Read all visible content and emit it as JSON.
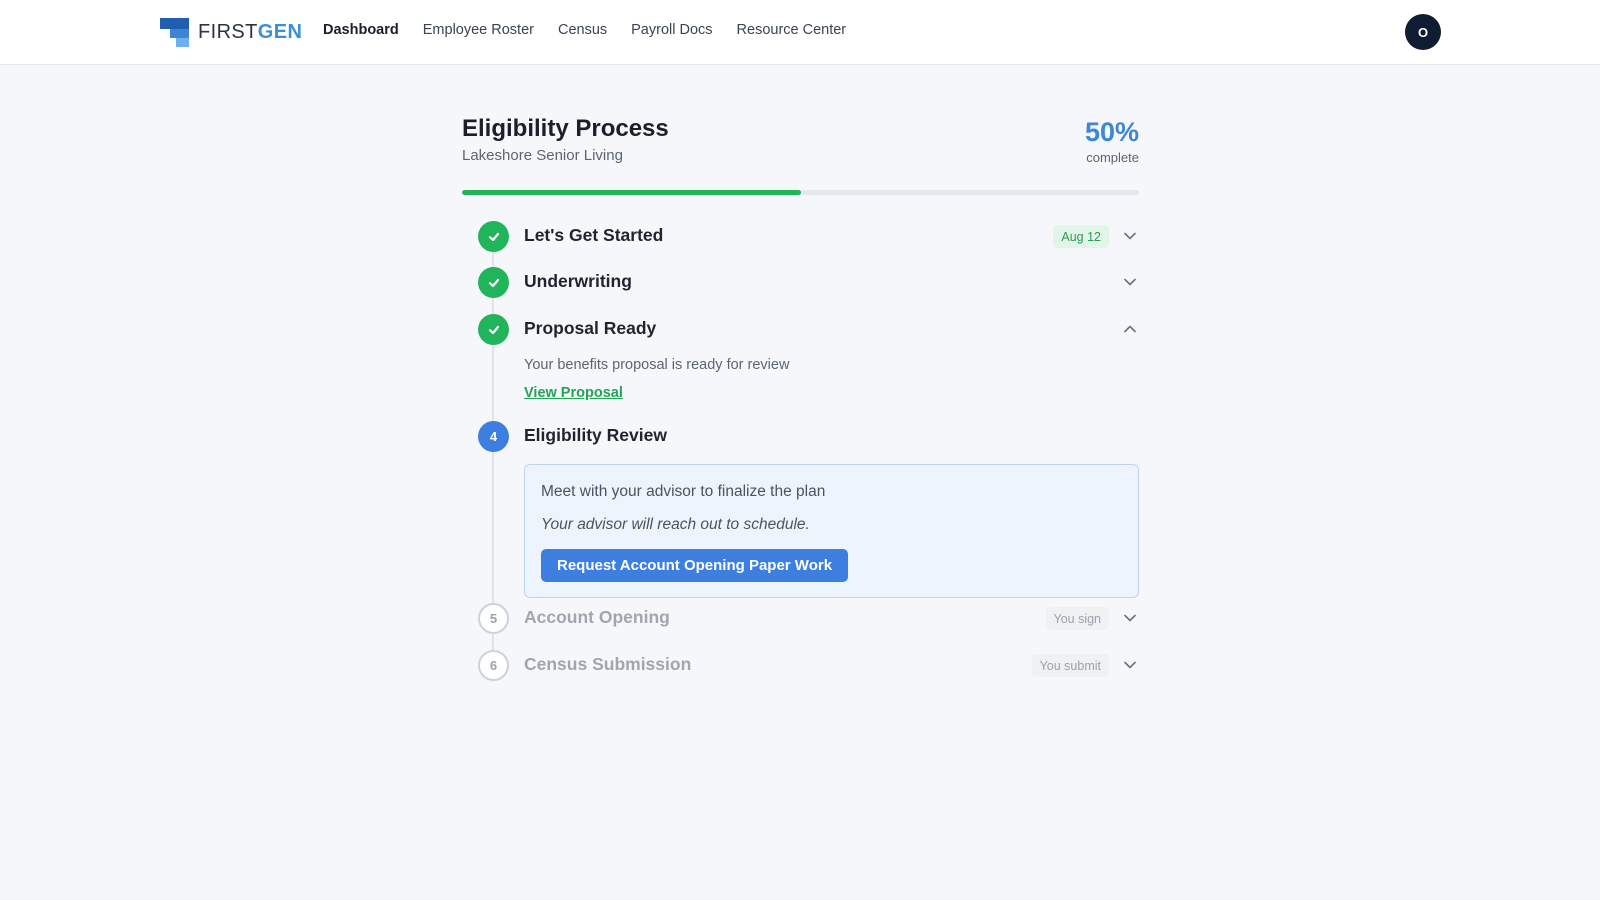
{
  "brand": {
    "first": "FIRST",
    "gen": "GEN",
    "colors": {
      "dark": "#1f5fae",
      "mid": "#3a86d4",
      "light": "#6fb1ee"
    }
  },
  "nav": {
    "items": [
      {
        "label": "Dashboard",
        "active": true
      },
      {
        "label": "Employee Roster",
        "active": false
      },
      {
        "label": "Census",
        "active": false
      },
      {
        "label": "Payroll Docs",
        "active": false
      },
      {
        "label": "Resource Center",
        "active": false
      }
    ]
  },
  "user": {
    "initial": "O"
  },
  "process": {
    "title": "Eligibility Process",
    "company": "Lakeshore Senior Living",
    "percent_text": "50%",
    "percent_label": "complete",
    "progress_value": 0.5
  },
  "steps": [
    {
      "number": "1",
      "status": "done",
      "title": "Let's Get Started",
      "badge": "Aug 12",
      "expanded": false
    },
    {
      "number": "2",
      "status": "done",
      "title": "Underwriting",
      "badge": "",
      "expanded": false
    },
    {
      "number": "3",
      "status": "done",
      "title": "Proposal Ready",
      "badge": "",
      "expanded": true,
      "description": "Your benefits proposal is ready for review",
      "link": "View Proposal"
    },
    {
      "number": "4",
      "status": "active",
      "title": "Eligibility Review",
      "expanded": true,
      "panel_text": "Meet with your advisor to finalize the plan",
      "panel_note": "Your advisor will reach out to schedule.",
      "button": "Request Account Opening Paper Work"
    },
    {
      "number": "5",
      "status": "todo",
      "title": "Account Opening",
      "badge": "You sign",
      "expanded": false
    },
    {
      "number": "6",
      "status": "todo",
      "title": "Census Submission",
      "badge": "You submit",
      "expanded": false
    }
  ],
  "colors": {
    "done": "#22b45a",
    "active": "#3d7fe0",
    "accent_percent": "#3d86d9",
    "avatar_bg": "#0f1d33"
  }
}
